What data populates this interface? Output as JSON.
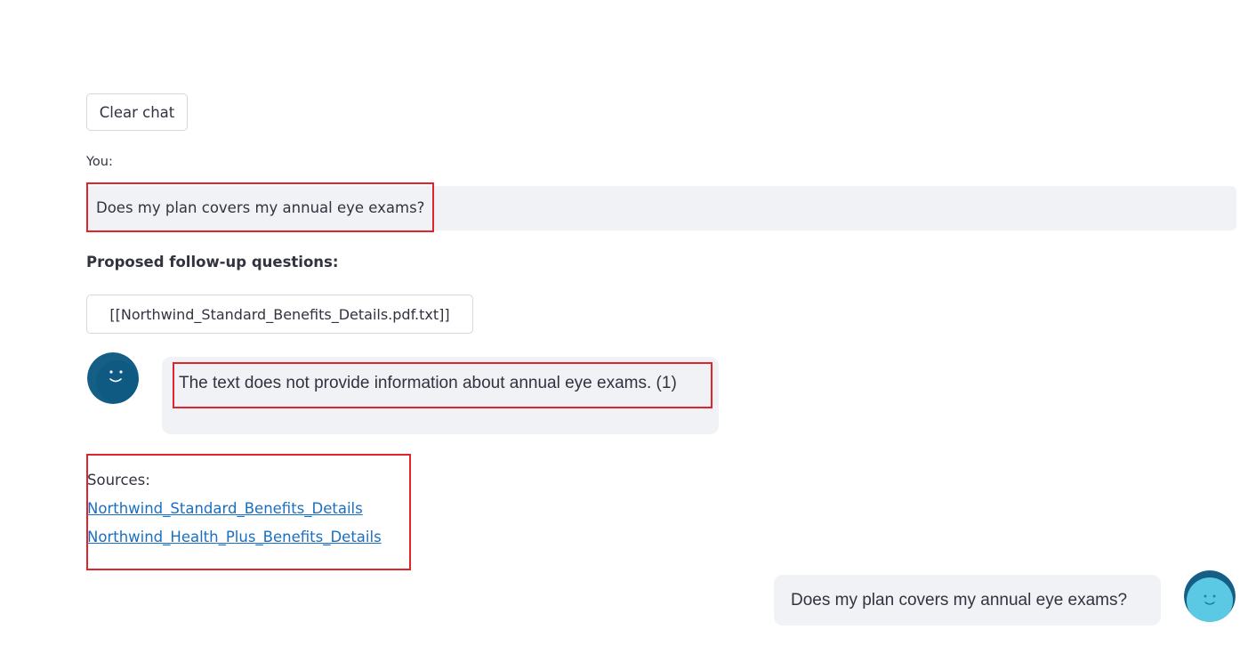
{
  "toolbar": {
    "clear_label": "Clear chat"
  },
  "chat": {
    "you_label": "You:",
    "user_message": "Does my plan covers my annual eye exams?",
    "followup_title": "Proposed follow-up questions:",
    "followup_question": "[[Northwind_Standard_Benefits_Details.pdf.txt]]",
    "bot_message": "The text does not provide information about annual eye exams. (1)",
    "sources_label": "Sources:",
    "sources": [
      "Northwind_Standard_Benefits_Details",
      "Northwind_Health_Plus_Benefits_Details"
    ],
    "user_message_bubble": "Does my plan covers my annual eye exams?"
  },
  "colors": {
    "highlight": "#e0242c",
    "bubble_bg": "#f0f2f6",
    "link": "#1a6fc2",
    "bot_avatar": "#155f87",
    "user_avatar": "#5bc8e4"
  },
  "icons": {
    "bot_avatar": "smiley-bot-avatar-icon",
    "user_avatar": "smiley-user-avatar-icon"
  }
}
